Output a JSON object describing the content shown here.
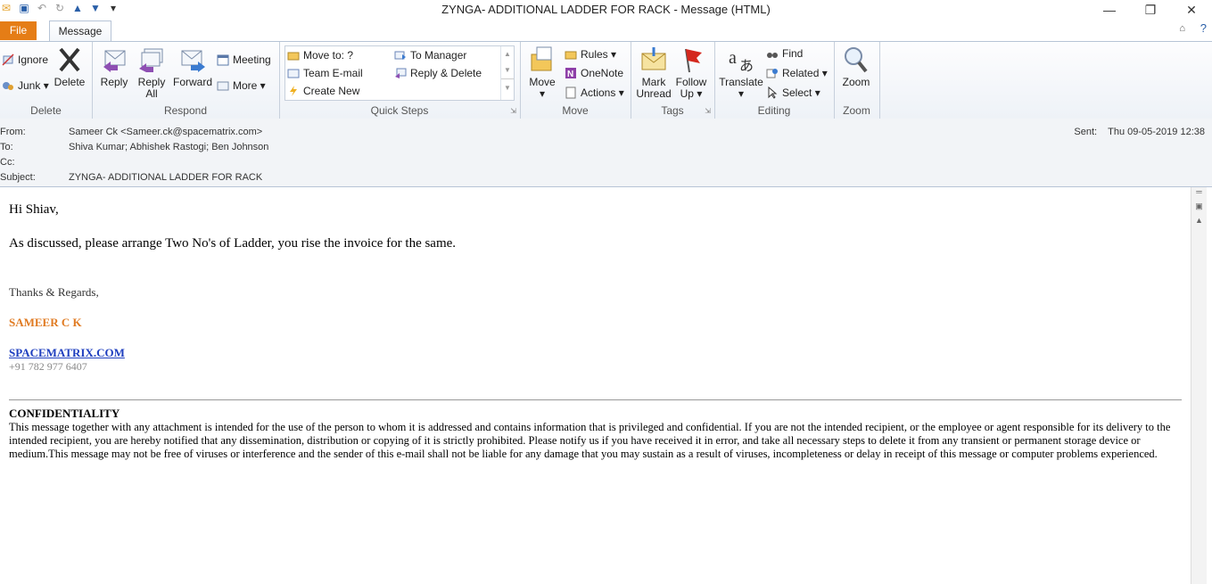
{
  "window": {
    "title": "ZYNGA- ADDITIONAL LADDER FOR RACK  -  Message (HTML)"
  },
  "tabs": {
    "file": "File",
    "message": "Message"
  },
  "ribbon": {
    "delete_group": {
      "label": "Delete",
      "ignore": "Ignore",
      "junk": "Junk",
      "delete": "Delete"
    },
    "respond_group": {
      "label": "Respond",
      "reply": "Reply",
      "reply_all_1": "Reply",
      "reply_all_2": "All",
      "forward": "Forward",
      "meeting": "Meeting",
      "more": "More"
    },
    "quick_steps_group": {
      "label": "Quick Steps",
      "move_to": "Move to: ?",
      "team_email": "Team E-mail",
      "create_new": "Create New",
      "to_manager": "To Manager",
      "reply_delete": "Reply & Delete"
    },
    "move_group": {
      "label": "Move",
      "move": "Move",
      "rules": "Rules",
      "onenote": "OneNote",
      "actions": "Actions"
    },
    "tags_group": {
      "label": "Tags",
      "mark_1": "Mark",
      "mark_2": "Unread",
      "follow_1": "Follow",
      "follow_2": "Up"
    },
    "editing_group": {
      "label": "Editing",
      "translate": "Translate",
      "find": "Find",
      "related": "Related",
      "select": "Select"
    },
    "zoom_group": {
      "label": "Zoom",
      "zoom": "Zoom"
    }
  },
  "header": {
    "from_label": "From:",
    "from_value": "Sameer Ck <Sameer.ck@spacematrix.com>",
    "to_label": "To:",
    "to_value": "Shiva Kumar; Abhishek Rastogi; Ben Johnson",
    "cc_label": "Cc:",
    "cc_value": "",
    "subject_label": "Subject:",
    "subject_value": "ZYNGA- ADDITIONAL LADDER FOR RACK",
    "sent_label": "Sent:",
    "sent_value": "Thu 09-05-2019 12:38"
  },
  "message": {
    "greeting": "Hi Shiav,",
    "line1": "As discussed, please arrange Two No's of Ladder, you rise the invoice for the same.",
    "regards": "Thanks & Regards,",
    "sender_name": "SAMEER C K",
    "company_link": "SPACEMATRIX.COM",
    "phone": "+91 782 977 6407",
    "confidentiality_title": "CONFIDENTIALITY",
    "confidentiality_text": "This message together with any attachment is intended for the use of the person to whom it is addressed and contains information that is privileged and confidential. If you are not the intended recipient, or the employee or agent responsible for its delivery to the intended recipient, you are hereby notified that any dissemination, distribution or copying of it is strictly prohibited. Please notify us if you have received it in error, and take all necessary steps to delete it from any transient or permanent storage device or medium.This message may not be free of viruses or interference and the sender of this e-mail shall not be liable for any damage that you may sustain as a result of viruses, incompleteness or delay in receipt of this message or computer problems experienced."
  },
  "colors": {
    "accent": "#e57d16",
    "sender": "#e07b23",
    "link": "#1f3fbf"
  }
}
